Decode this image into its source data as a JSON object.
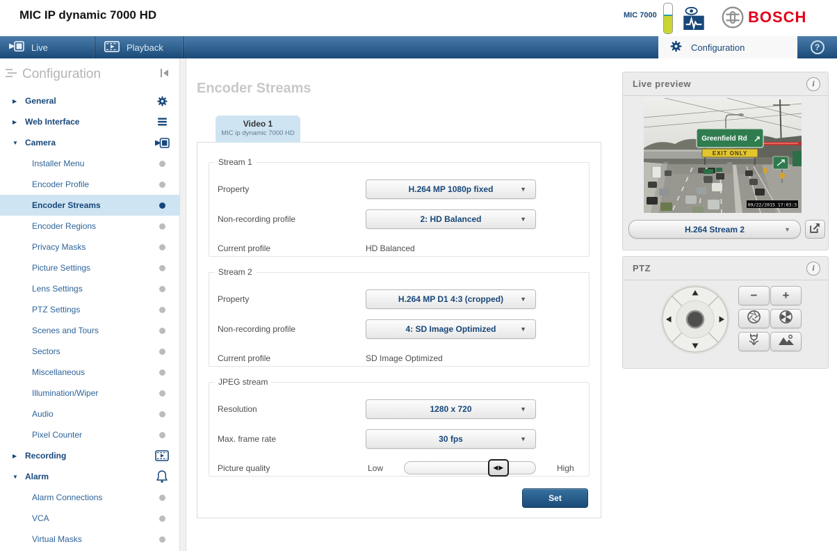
{
  "header": {
    "title": "MIC IP dynamic 7000 HD",
    "device_label": "MIC 7000",
    "brand": "BOSCH"
  },
  "nav": {
    "live": "Live",
    "playback": "Playback",
    "configuration": "Configuration"
  },
  "sidebar": {
    "title": "Configuration",
    "items": [
      {
        "label": "General",
        "arrow": "▶",
        "icon": "gear-icon"
      },
      {
        "label": "Web Interface",
        "arrow": "▶",
        "icon": "menu-icon"
      },
      {
        "label": "Camera",
        "arrow": "▼",
        "icon": "camera-icon"
      },
      {
        "label": "Installer Menu",
        "dot": "gray"
      },
      {
        "label": "Encoder Profile",
        "dot": "gray"
      },
      {
        "label": "Encoder Streams",
        "dot": "blue",
        "selected": true
      },
      {
        "label": "Encoder Regions",
        "dot": "gray"
      },
      {
        "label": "Privacy Masks",
        "dot": "gray"
      },
      {
        "label": "Picture Settings",
        "dot": "gray"
      },
      {
        "label": "Lens Settings",
        "dot": "gray"
      },
      {
        "label": "PTZ Settings",
        "dot": "gray"
      },
      {
        "label": "Scenes and Tours",
        "dot": "gray"
      },
      {
        "label": "Sectors",
        "dot": "gray"
      },
      {
        "label": "Miscellaneous",
        "dot": "gray"
      },
      {
        "label": "Illumination/Wiper",
        "dot": "gray"
      },
      {
        "label": "Audio",
        "dot": "gray"
      },
      {
        "label": "Pixel Counter",
        "dot": "gray"
      },
      {
        "label": "Recording",
        "arrow": "▶",
        "icon": "recording-icon"
      },
      {
        "label": "Alarm",
        "arrow": "▼",
        "icon": "bell-icon"
      },
      {
        "label": "Alarm Connections",
        "dot": "gray"
      },
      {
        "label": "VCA",
        "dot": "gray"
      },
      {
        "label": "Virtual Masks",
        "dot": "gray"
      }
    ]
  },
  "main": {
    "page_title": "Encoder Streams",
    "tab": {
      "title": "Video 1",
      "subtitle": "MIC ip dynamic 7000 HD"
    },
    "stream1": {
      "legend": "Stream 1",
      "property_label": "Property",
      "property_value": "H.264 MP 1080p fixed",
      "profile_label": "Non-recording profile",
      "profile_value": "2: HD Balanced",
      "current_label": "Current profile",
      "current_value": "HD Balanced"
    },
    "stream2": {
      "legend": "Stream 2",
      "property_label": "Property",
      "property_value": "H.264 MP D1 4:3 (cropped)",
      "profile_label": "Non-recording profile",
      "profile_value": "4: SD Image Optimized",
      "current_label": "Current profile",
      "current_value": "SD Image Optimized"
    },
    "jpeg": {
      "legend": "JPEG stream",
      "resolution_label": "Resolution",
      "resolution_value": "1280 x 720",
      "framerate_label": "Max. frame rate",
      "framerate_value": "30 fps",
      "quality_label": "Picture quality",
      "low": "Low",
      "high": "High",
      "slider_position_percent": 64
    },
    "set_button": "Set"
  },
  "preview": {
    "title": "Live preview",
    "stream_selector": "H.264 Stream 2",
    "sign_road": "Greenfield Rd",
    "sign_arrow": "↗",
    "sign_exit": "EXIT ONLY",
    "timestamp": "09/22/2015 17:03:3"
  },
  "ptz": {
    "title": "PTZ",
    "zoom_out": "−",
    "zoom_in": "+"
  },
  "icons": {
    "dropdown_arrow": "▼",
    "help": "?",
    "info": "i",
    "slider_handle": "◀▶"
  },
  "colors": {
    "accent_blue": "#17477a",
    "bosch_red": "#e2001a",
    "selected_bg": "#cfe4f2",
    "battery_fill": "#c9d530",
    "nav_gradient_top": "#4a7cab",
    "nav_gradient_bottom": "#1a4a78"
  }
}
